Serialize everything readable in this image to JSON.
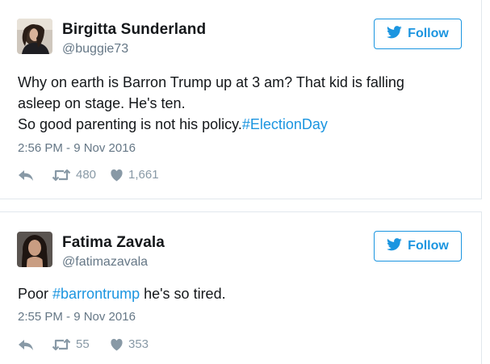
{
  "tweets": [
    {
      "name": "Birgitta Sunderland",
      "handle": "@buggie73",
      "follow_label": "Follow",
      "text_lines": [
        "Why on earth is Barron Trump up at 3 am? That kid is falling",
        "asleep on stage. He's ten."
      ],
      "text_last_plain": "So good parenting is not his policy.",
      "text_last_tag": "#ElectionDay",
      "time": "2:56 PM - 9 Nov 2016",
      "retweets": "480",
      "likes": "1,661"
    },
    {
      "name": "Fatima Zavala",
      "handle": "@fatimazavala",
      "follow_label": "Follow",
      "text_prefix": "Poor ",
      "text_tag": "#barrontrump",
      "text_suffix": " he's so tired.",
      "time": "2:55 PM - 9 Nov 2016",
      "retweets": "55",
      "likes": "353"
    }
  ],
  "colors": {
    "accent": "#1b95e0",
    "secondary_text": "#657786",
    "action_icon": "#8899a6",
    "border": "#e1e8ed"
  },
  "icons": {
    "follow": "twitter-bird-icon",
    "reply": "reply-icon",
    "retweet": "retweet-icon",
    "like": "heart-icon"
  }
}
